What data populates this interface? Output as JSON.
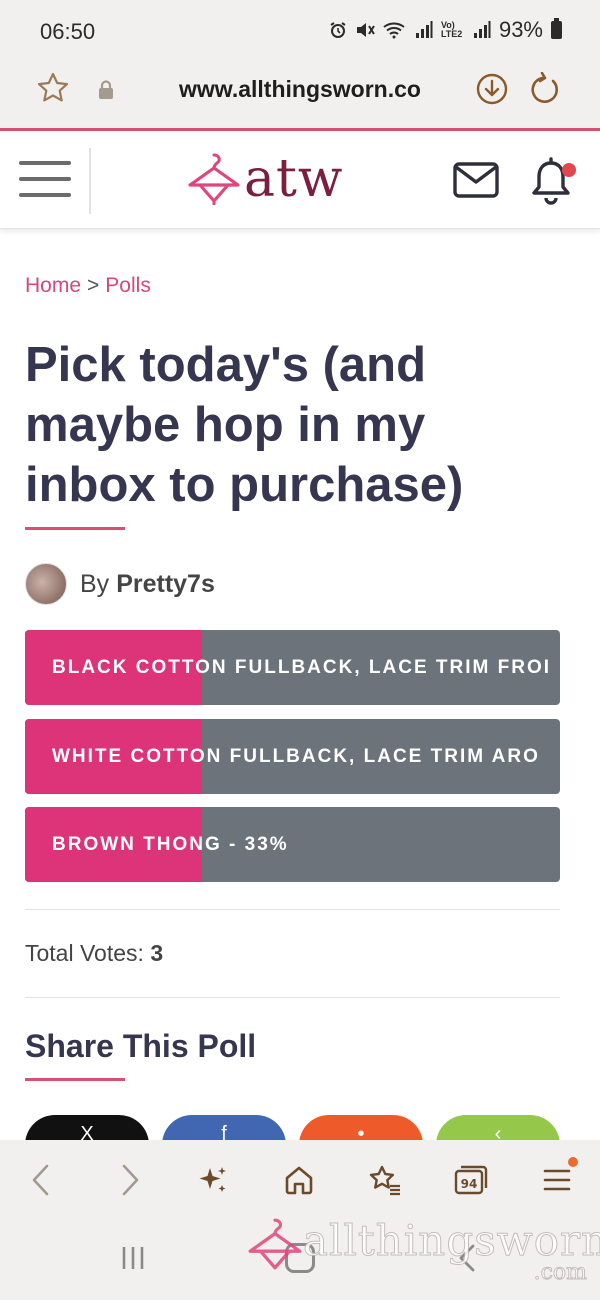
{
  "status_bar": {
    "time": "06:50",
    "battery": "93%",
    "network_label": "Vo) LTE2"
  },
  "browser": {
    "url": "www.allthingsworn.co"
  },
  "site": {
    "logo_text": "atw",
    "brand_color": "#7a1f3d",
    "accent_color": "#d9506f"
  },
  "breadcrumb": {
    "home": "Home",
    "separator": ">",
    "current": "Polls"
  },
  "page": {
    "title": "Pick today's (and maybe hop in my inbox to purchase)",
    "by_label": "By",
    "author": "Pretty7s"
  },
  "poll": {
    "fill_color": "#dc3379",
    "track_color": "#6c737a",
    "options": [
      {
        "label": "BLACK COTTON FULLBACK, LACE TRIM FROI",
        "percent": 33
      },
      {
        "label": "WHITE COTTON FULLBACK, LACE TRIM ARO",
        "percent": 33
      },
      {
        "label": "BROWN THONG - 33%",
        "percent": 33
      }
    ],
    "total_votes_label": "Total Votes:",
    "total_votes_value": "3"
  },
  "share": {
    "title": "Share This Poll",
    "buttons": [
      {
        "name": "x",
        "glyph": "X"
      },
      {
        "name": "facebook",
        "glyph": "f"
      },
      {
        "name": "reddit",
        "glyph": "•"
      },
      {
        "name": "share",
        "glyph": "‹"
      }
    ]
  },
  "toolbar": {
    "tabs_count": "94"
  },
  "watermark": {
    "text": "allthingsworn",
    "suffix": ".com"
  }
}
